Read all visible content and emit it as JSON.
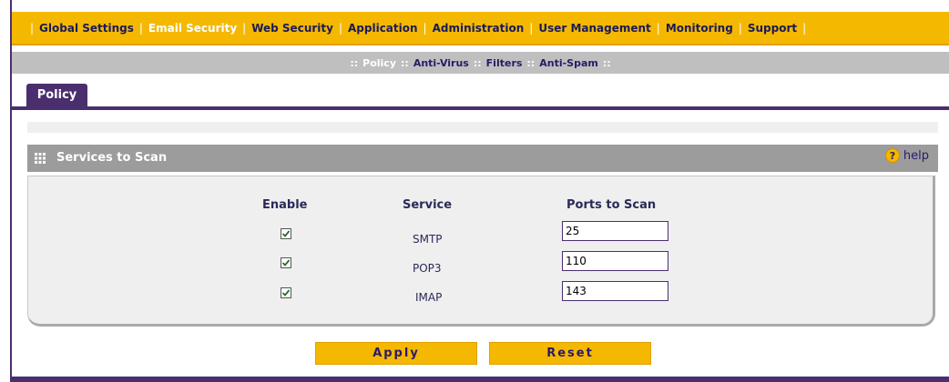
{
  "topnav": {
    "items": [
      "Global Settings",
      "Email Security",
      "Web Security",
      "Application",
      "Administration",
      "User Management",
      "Monitoring",
      "Support"
    ],
    "active": "Email Security"
  },
  "subnav": {
    "items": [
      "Policy",
      "Anti-Virus",
      "Filters",
      "Anti-Spam"
    ],
    "active": "Policy"
  },
  "tab": {
    "label": "Policy"
  },
  "section": {
    "title": "Services to Scan",
    "help_label": "help"
  },
  "table": {
    "headers": {
      "enable": "Enable",
      "service": "Service",
      "ports": "Ports to Scan"
    },
    "rows": [
      {
        "enabled": true,
        "service": "SMTP",
        "ports": "25"
      },
      {
        "enabled": true,
        "service": "POP3",
        "ports": "110"
      },
      {
        "enabled": true,
        "service": "IMAP",
        "ports": "143"
      }
    ]
  },
  "buttons": {
    "apply": "Apply",
    "reset": "Reset"
  },
  "colors": {
    "nav_yellow": "#f5b800",
    "brand_purple": "#4b2e6e",
    "section_grey": "#9c9c9c"
  }
}
